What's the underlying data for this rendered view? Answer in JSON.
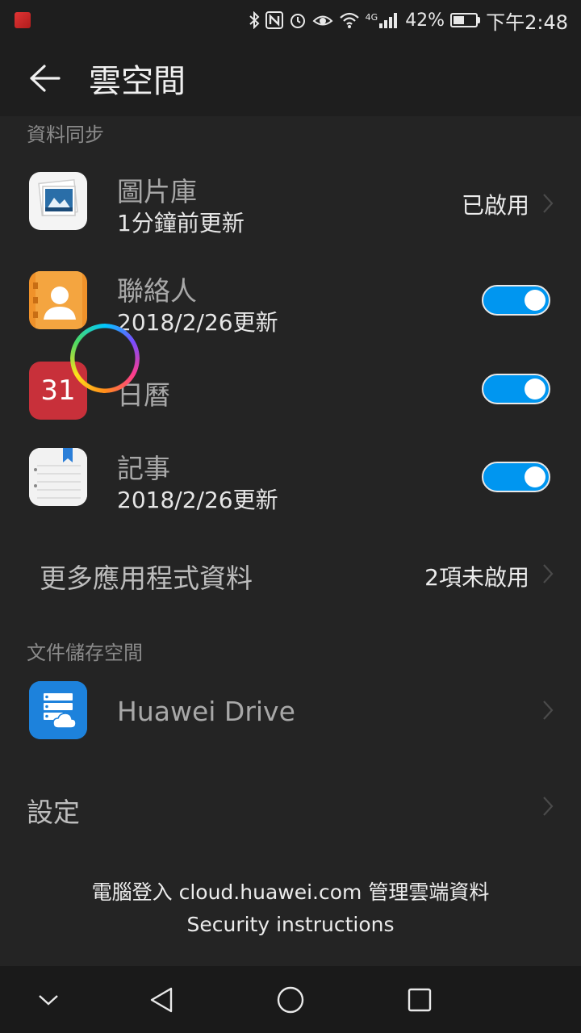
{
  "status_bar": {
    "battery_percent": "42%",
    "network": "4G",
    "time": "下午2:48"
  },
  "header": {
    "title": "雲空間"
  },
  "sections": {
    "sync": "資料同步",
    "storage": "文件儲存空間"
  },
  "sync_items": [
    {
      "title": "圖片庫",
      "subtitle": "1分鐘前更新",
      "status": "已啟用",
      "icon": "gallery-icon"
    },
    {
      "title": "聯絡人",
      "subtitle": "2018/2/26更新",
      "toggle": true,
      "icon": "contacts-icon"
    },
    {
      "title": "日曆",
      "subtitle": "",
      "toggle": true,
      "icon": "calendar-icon",
      "icon_text": "31"
    },
    {
      "title": "記事",
      "subtitle": "2018/2/26更新",
      "toggle": true,
      "icon": "notes-icon"
    }
  ],
  "more_apps": {
    "label": "更多應用程式資料",
    "status": "2項未啟用"
  },
  "drive": {
    "label": "Huawei Drive",
    "icon": "huawei-drive-icon"
  },
  "settings": {
    "label": "設定"
  },
  "footer": {
    "login_text": "電腦登入 cloud.huawei.com 管理雲端資料",
    "security_link": "Security instructions"
  },
  "colors": {
    "background": "#242424",
    "toggle_on": "#0096f0",
    "section_header": "#8a8a8a"
  }
}
